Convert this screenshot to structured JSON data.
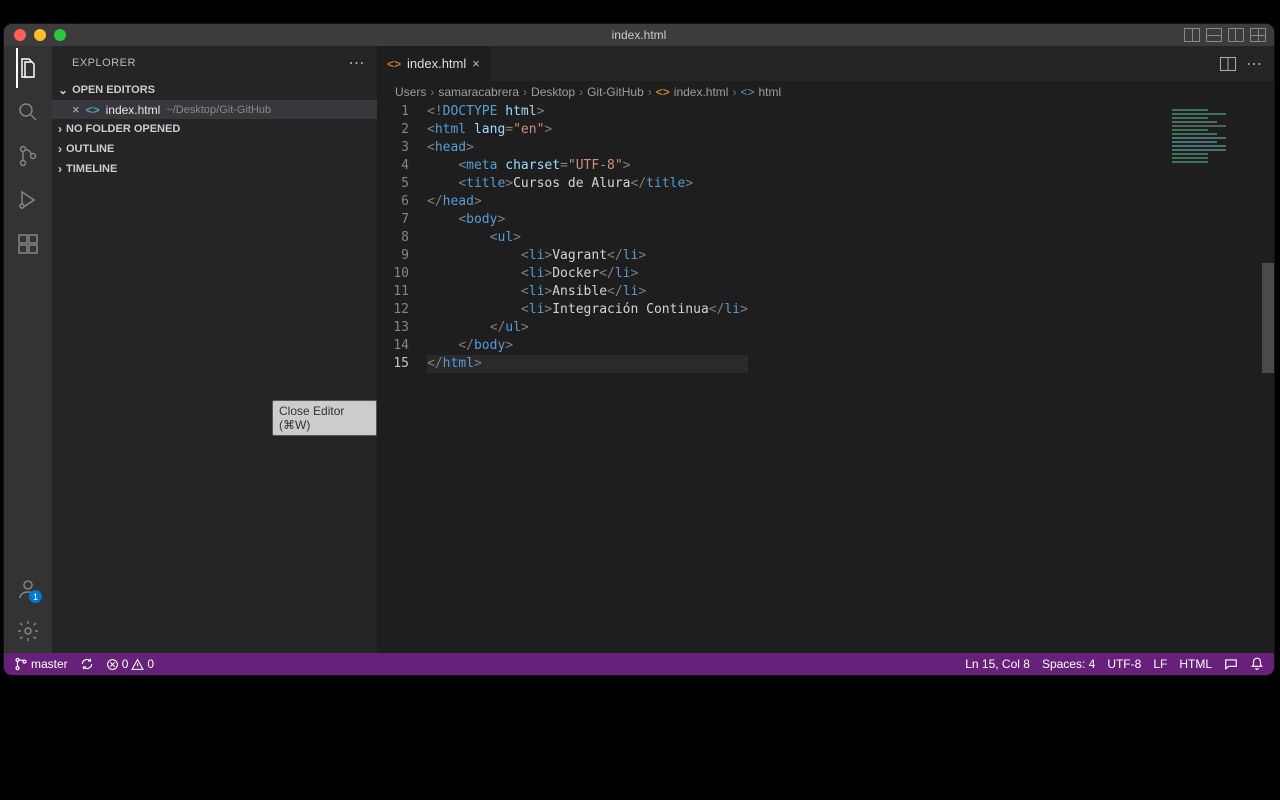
{
  "titlebar": {
    "title": "index.html"
  },
  "sidebar": {
    "title": "EXPLORER",
    "sections": {
      "open_editors": "OPEN EDITORS",
      "no_folder": "NO FOLDER OPENED",
      "outline": "OUTLINE",
      "timeline": "TIMELINE"
    },
    "open_editor_item": {
      "filename": "index.html",
      "path": "~/Desktop/Git-GitHub"
    }
  },
  "accounts_badge": "1",
  "tooltip": "Close Editor (⌘W)",
  "tab": {
    "filename": "index.html"
  },
  "breadcrumb": [
    "Users",
    "samaracabrera",
    "Desktop",
    "Git-GitHub",
    "index.html",
    "html"
  ],
  "code": {
    "lines": [
      {
        "n": 1,
        "html": "<span class='tk-pun'>&lt;!</span><span class='tk-tag'>DOCTYPE</span> <span class='tk-attr'>html</span><span class='tk-pun'>&gt;</span>"
      },
      {
        "n": 2,
        "html": "<span class='tk-pun'>&lt;</span><span class='tk-tag'>html</span> <span class='tk-attr'>lang</span><span class='tk-pun'>=</span><span class='tk-val'>\"en\"</span><span class='tk-pun'>&gt;</span>"
      },
      {
        "n": 3,
        "html": "<span class='tk-pun'>&lt;</span><span class='tk-tag'>head</span><span class='tk-pun'>&gt;</span>"
      },
      {
        "n": 4,
        "html": "    <span class='tk-pun'>&lt;</span><span class='tk-tag'>meta</span> <span class='tk-attr'>charset</span><span class='tk-pun'>=</span><span class='tk-val'>\"UTF-8\"</span><span class='tk-pun'>&gt;</span>"
      },
      {
        "n": 5,
        "html": "    <span class='tk-pun'>&lt;</span><span class='tk-tag'>title</span><span class='tk-pun'>&gt;</span><span class='tk-text'>Cursos de Alura</span><span class='tk-pun'>&lt;/</span><span class='tk-tag'>title</span><span class='tk-pun'>&gt;</span>"
      },
      {
        "n": 6,
        "html": "<span class='tk-pun'>&lt;/</span><span class='tk-tag'>head</span><span class='tk-pun'>&gt;</span>"
      },
      {
        "n": 7,
        "html": "    <span class='tk-pun'>&lt;</span><span class='tk-tag'>body</span><span class='tk-pun'>&gt;</span>"
      },
      {
        "n": 8,
        "html": "        <span class='tk-pun'>&lt;</span><span class='tk-tag'>ul</span><span class='tk-pun'>&gt;</span>"
      },
      {
        "n": 9,
        "html": "            <span class='tk-pun'>&lt;</span><span class='tk-tag'>li</span><span class='tk-pun'>&gt;</span><span class='tk-text'>Vagrant</span><span class='tk-pun'>&lt;/</span><span class='tk-tag'>li</span><span class='tk-pun'>&gt;</span>"
      },
      {
        "n": 10,
        "html": "            <span class='tk-pun'>&lt;</span><span class='tk-tag'>li</span><span class='tk-pun'>&gt;</span><span class='tk-text'>Docker</span><span class='tk-pun'>&lt;/</span><span class='tk-tag'>li</span><span class='tk-pun'>&gt;</span>"
      },
      {
        "n": 11,
        "html": "            <span class='tk-pun'>&lt;</span><span class='tk-tag'>li</span><span class='tk-pun'>&gt;</span><span class='tk-text'>Ansible</span><span class='tk-pun'>&lt;/</span><span class='tk-tag'>li</span><span class='tk-pun'>&gt;</span>"
      },
      {
        "n": 12,
        "html": "            <span class='tk-pun'>&lt;</span><span class='tk-tag'>li</span><span class='tk-pun'>&gt;</span><span class='tk-text'>Integración Continua</span><span class='tk-pun'>&lt;/</span><span class='tk-tag'>li</span><span class='tk-pun'>&gt;</span>"
      },
      {
        "n": 13,
        "html": "        <span class='tk-pun'>&lt;/</span><span class='tk-tag'>ul</span><span class='tk-pun'>&gt;</span>"
      },
      {
        "n": 14,
        "html": "    <span class='tk-pun'>&lt;/</span><span class='tk-tag'>body</span><span class='tk-pun'>&gt;</span>"
      },
      {
        "n": 15,
        "html": "<span class='tk-pun'>&lt;/</span><span class='tk-tag'>html</span><span class='tk-pun'>&gt;</span>"
      }
    ],
    "current_line": 15
  },
  "statusbar": {
    "branch": "master",
    "errors": "0",
    "warnings": "0",
    "position": "Ln 15, Col 8",
    "spaces": "Spaces: 4",
    "encoding": "UTF-8",
    "eol": "LF",
    "language": "HTML"
  }
}
